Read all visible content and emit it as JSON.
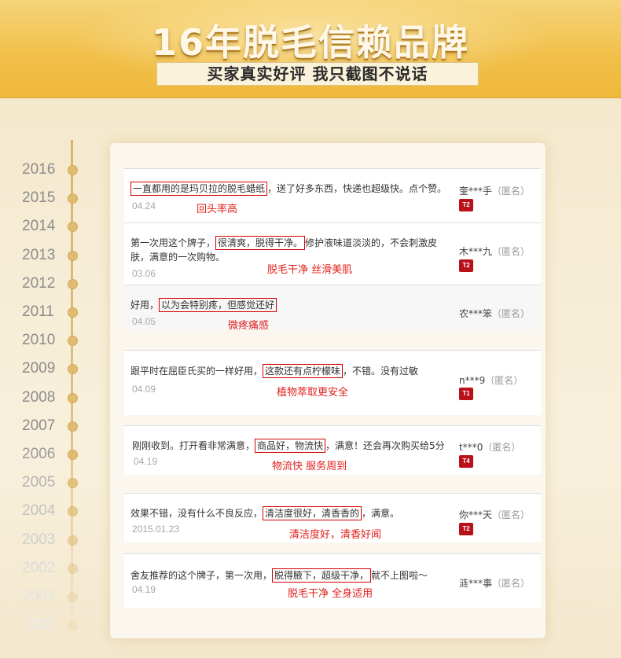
{
  "header": {
    "title": "16年脱毛信赖品牌",
    "subtitle": "买家真实好评 我只截图不说话"
  },
  "timeline": {
    "years": [
      "2016",
      "2015",
      "2014",
      "2013",
      "2012",
      "2011",
      "2010",
      "2009",
      "2008",
      "2007",
      "2006",
      "2005",
      "2004",
      "2003",
      "2002",
      "2001",
      "2000"
    ],
    "year_colors": [
      "#8c8c8c",
      "#8c8c8c",
      "#8c8c8c",
      "#8c8c8c",
      "#8c8c8c",
      "#8c8c8c",
      "#8c8c8c",
      "#8c8c8c",
      "#8c8c8c",
      "#8c8c8c",
      "#9a9a9a",
      "#b3b3b3",
      "#c3c3c3",
      "#d0d0d0",
      "#dcdcdc",
      "#e4e4e4",
      "#ececec"
    ]
  },
  "reviews": [
    {
      "pre": "",
      "highlight": "一直都用的是玛贝拉的脱毛蜡纸",
      "post": "，送了好多东西，快递也超级快。点个赞。",
      "date": "04.24",
      "note": "回头率高",
      "user": "奎***手",
      "anon": "（匿名）",
      "badge": "T2"
    },
    {
      "pre": "第一次用这个牌子，",
      "highlight": "很清爽，脱得干净。",
      "post": "修护液味道淡淡的，不会刺激皮肤，满意的一次购物。",
      "date": "03.06",
      "note": "脱毛干净 丝滑美肌",
      "user": "木***九",
      "anon": "（匿名）",
      "badge": "T2"
    },
    {
      "pre": "好用，",
      "highlight": "以为会特别疼，但感觉还好",
      "post": "",
      "date": "04.05",
      "note": "微疼痛感",
      "user": "农***笨",
      "anon": "（匿名）",
      "badge": ""
    },
    {
      "pre": "跟平时在屈臣氏买的一样好用，",
      "highlight": "这款还有点柠檬味",
      "post": "，不错。没有过敏",
      "date": "04.09",
      "note": "植物萃取更安全",
      "user": "n***9",
      "anon": "（匿名）",
      "badge": "T1"
    },
    {
      "pre": "刚刚收到。打开看非常满意，",
      "highlight": "商品好，物流快",
      "post": "，满意！还会再次购买给5分",
      "date": "04.19",
      "note": "物流快 服务周到",
      "user": "t***0",
      "anon": "（匿名）",
      "badge": "T4"
    },
    {
      "pre": "效果不错，没有什么不良反应，",
      "highlight": "清洁度很好，清香香的",
      "post": "，满意。",
      "date": "2015.01.23",
      "note": "清洁度好，清香好闻",
      "user": "你***天",
      "anon": "（匿名）",
      "badge": "T2"
    },
    {
      "pre": "舍友推荐的这个牌子，第一次用，",
      "highlight": "脱得腋下，超级干净，",
      "post": "就不上图啦～",
      "date": "04.19",
      "note": "脱毛干净 全身适用",
      "user": "涟***事",
      "anon": "（匿名）",
      "badge": ""
    }
  ]
}
